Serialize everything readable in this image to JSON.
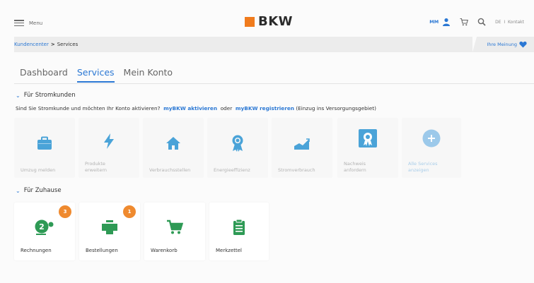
{
  "header": {
    "menu_label": "Menu",
    "logo_text": "BKW",
    "user_initials": "MM",
    "language": "DE",
    "divider": "I",
    "contact": "Kontakt"
  },
  "breadcrumb": {
    "root": "Kundencenter",
    "separator": ">",
    "current": "Services",
    "feedback_label": "Ihre Meinung"
  },
  "tabs": [
    {
      "label": "Dashboard",
      "active": false
    },
    {
      "label": "Services",
      "active": true
    },
    {
      "label": "Mein Konto",
      "active": false
    }
  ],
  "strom": {
    "heading": "Für Stromkunden",
    "intro_text": "Sind Sie Stromkunde und möchten Ihr Konto aktivieren?",
    "link_activate": "myBKW aktivieren",
    "or_text": "oder",
    "link_register": "myBKW registrieren",
    "suffix_text": "(Einzug ins Versorgungsgebiet)",
    "tiles": [
      {
        "label": "Umzug melden",
        "icon": "briefcase-icon"
      },
      {
        "label": "Produkte erweitern",
        "icon": "lightning-icon"
      },
      {
        "label": "Verbrauchsstellen",
        "icon": "house-icon"
      },
      {
        "label": "Energieeffizienz",
        "icon": "award-ribbon-icon"
      },
      {
        "label": "Stromverbrauch",
        "icon": "area-chart-icon"
      },
      {
        "label": "Nachweis anfordern",
        "icon": "certificate-icon"
      },
      {
        "label": "Alle Services anzeigen",
        "icon": "plus-circle-icon"
      }
    ]
  },
  "home": {
    "heading": "Für Zuhause",
    "tiles": [
      {
        "label": "Rechnungen",
        "icon": "invoice-icon",
        "badge": "3"
      },
      {
        "label": "Bestellungen",
        "icon": "package-icon",
        "badge": "1"
      },
      {
        "label": "Warenkorb",
        "icon": "cart-icon"
      },
      {
        "label": "Merkzettel",
        "icon": "clipboard-icon"
      }
    ]
  },
  "colors": {
    "accent_blue": "#2b78d4",
    "tile_blue": "#4aa3d8",
    "brand_orange": "#f07b1d",
    "badge_orange": "#ef8a2f",
    "icon_green": "#2e9a55"
  }
}
